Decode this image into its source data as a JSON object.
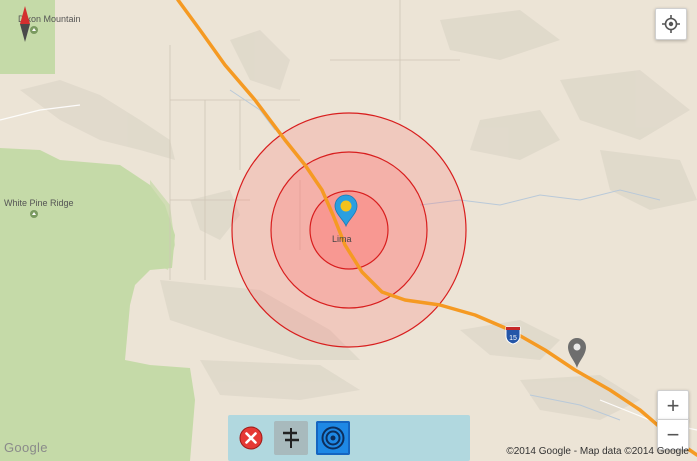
{
  "map": {
    "place_labels": {
      "mountain": "Dixon Mountain",
      "ridge": "White Pine Ridge",
      "town": "Lima",
      "highway_shield": "15"
    },
    "copyright": "©2014 Google - Map data ©2014 Google",
    "logo": "Google",
    "colors": {
      "land": "#ece4d6",
      "forest": "#bfd9a0",
      "road": "#f59a23",
      "radius_fill": "#ff5a5a",
      "radius_stroke": "#d81e1e",
      "pin_blue": "#2a9fe0",
      "pin_yellow": "#f4c21b",
      "pin_grey": "#6e6e6e"
    },
    "radius_rings": 3
  },
  "controls": {
    "my_location_icon": "crosshair-icon",
    "zoom_in_label": "+",
    "zoom_out_label": "−",
    "compass_icon": "compass-icon"
  },
  "toolbar": {
    "buttons": [
      {
        "icon": "close-circle-icon",
        "color": "#e53935"
      },
      {
        "icon": "signpost-icon",
        "color": "#333333"
      },
      {
        "icon": "target-icon",
        "color": "#1565c0"
      }
    ]
  }
}
